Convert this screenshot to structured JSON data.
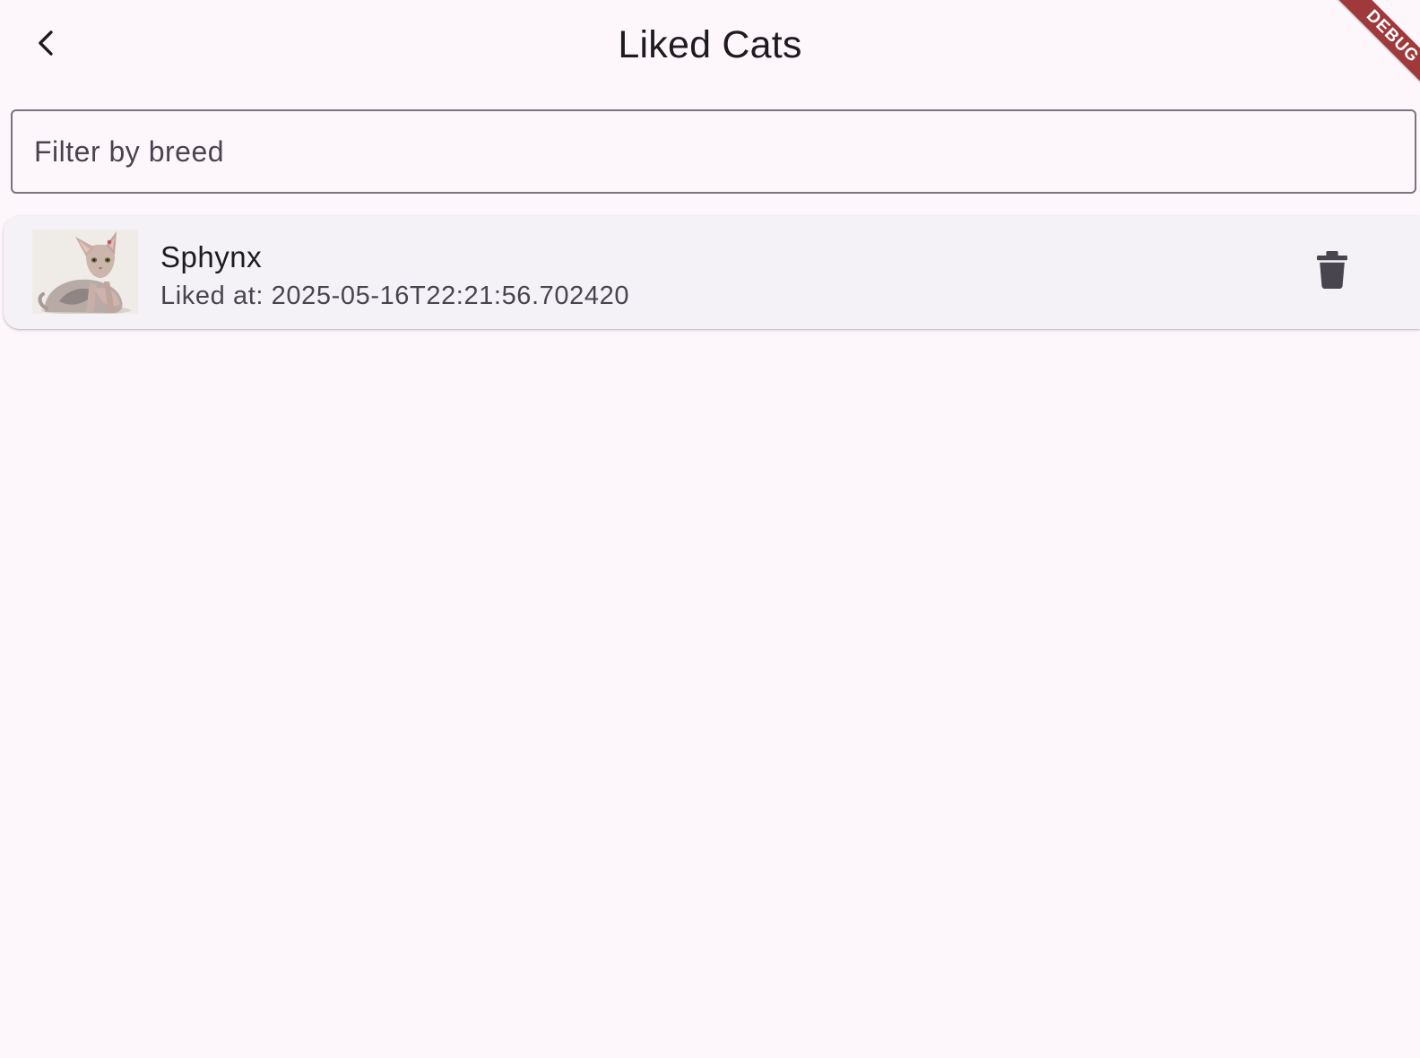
{
  "app_bar": {
    "title": "Liked Cats",
    "back_icon": "chevron-left-icon"
  },
  "debug_banner": {
    "label": "DEBUG"
  },
  "filter": {
    "placeholder": "Filter by breed",
    "value": ""
  },
  "liked_cats": [
    {
      "breed": "Sphynx",
      "liked_at": "Liked at: 2025-05-16T22:21:56.702420",
      "delete_icon": "trash-icon"
    }
  ],
  "colors": {
    "background": "#fdf7fc",
    "card": "#f4f2f7",
    "text_primary": "#1d1b20",
    "text_secondary": "#49454f",
    "outline": "#79747e",
    "debug_banner": "#a0393c"
  }
}
